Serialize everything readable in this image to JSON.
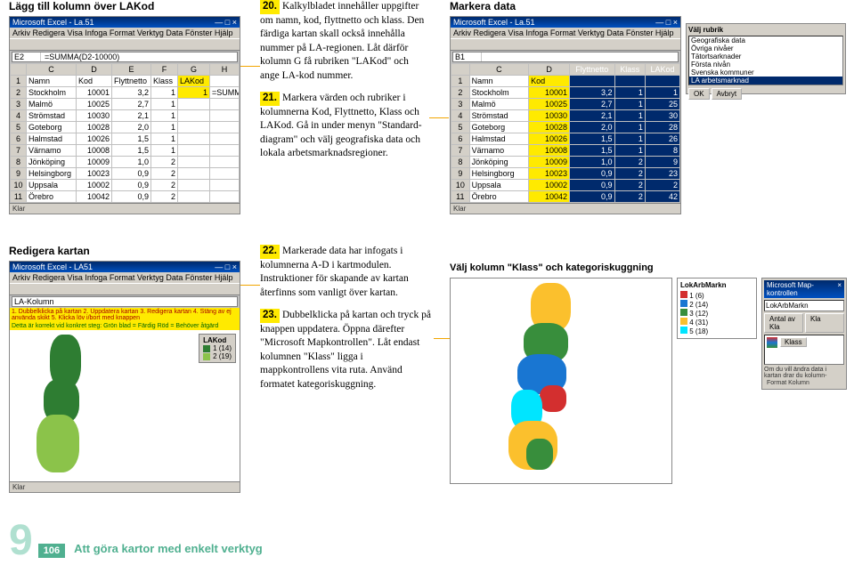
{
  "headings": {
    "h1": "Lägg till kolumn över LAKod",
    "h2": "Markera data",
    "h3": "Redigera kartan",
    "h4": "Välj kolumn \"Klass\" och kategoriskuggning"
  },
  "steps": {
    "s20": {
      "num": "20.",
      "text": "Kalkylbladet innehåller uppgifter om namn, kod, flyttnetto och klass. Den färdiga kartan skall också innehålla nummer på LA-regionen. Låt därför kolumn G få rubriken \"LAKod\" och ange LA-kod nummer."
    },
    "s21": {
      "num": "21.",
      "text": "Markera värden och rubriker i kolumnerna Kod, Flyttnetto, Klass och LAKod. Gå in under menyn \"Standard-diagram\" och välj geografiska data och lokala arbetsmarknadsregioner."
    },
    "s22": {
      "num": "22.",
      "text": "Markerade data har infogats i kolumnerna A-D i kartmodulen. Instruktioner för skapande av kartan återfinns som vanligt över kartan."
    },
    "s23": {
      "num": "23.",
      "text": "Dubbelklicka på kartan och tryck på knappen uppdatera. Öppna därefter \"Microsoft Mapkontrollen\". Låt endast kolumnen \"Klass\" ligga i mappkontrollens vita ruta. Använd formatet kategoriskuggning."
    }
  },
  "excel_common": {
    "title": "Microsoft Excel - La.51",
    "menus": "Arkiv  Redigera  Visa  Infoga  Format  Verktyg  Data  Fönster  Hjälp",
    "status": "Klar"
  },
  "fig1": {
    "formula_ref": "E2",
    "formula_val": "=SUMMA(D2-10000)",
    "cols": [
      "",
      "C",
      "D",
      "E",
      "F",
      "G",
      "H"
    ],
    "header_row": [
      "1",
      "Namn",
      "Kod",
      "Flyttnetto",
      "Klass",
      "LAKod",
      ""
    ],
    "rows": [
      [
        "2",
        "Stockholm",
        "10001",
        "3,2",
        "1",
        "1",
        "=SUMMA(D2-10000)"
      ],
      [
        "3",
        "Malmö",
        "10025",
        "2,7",
        "1",
        "",
        ""
      ],
      [
        "4",
        "Strömstad",
        "10030",
        "2,1",
        "1",
        "",
        ""
      ],
      [
        "5",
        "Goteborg",
        "10028",
        "2,0",
        "1",
        "",
        ""
      ],
      [
        "6",
        "Halmstad",
        "10026",
        "1,5",
        "1",
        "",
        ""
      ],
      [
        "7",
        "Värnamo",
        "10008",
        "1,5",
        "1",
        "",
        ""
      ],
      [
        "8",
        "Jönköping",
        "10009",
        "1,0",
        "2",
        "",
        ""
      ],
      [
        "9",
        "Helsingborg",
        "10023",
        "0,9",
        "2",
        "",
        ""
      ],
      [
        "10",
        "Uppsala",
        "10002",
        "0,9",
        "2",
        "",
        ""
      ],
      [
        "11",
        "Örebro",
        "10042",
        "0,9",
        "2",
        "",
        ""
      ]
    ]
  },
  "fig2": {
    "formula_ref": "B1",
    "cols": [
      "",
      "C",
      "D"
    ],
    "header_row": [
      "1",
      "Namn",
      "Kod"
    ],
    "rows": [
      [
        "2",
        "Stockholm",
        "10001",
        "3,2",
        "1"
      ],
      [
        "3",
        "Malmö",
        "10025",
        "2,7",
        "1"
      ],
      [
        "4",
        "Strömstad",
        "10030",
        "2,1",
        "1"
      ],
      [
        "5",
        "Goteborg",
        "10028",
        "2,0",
        "1"
      ],
      [
        "6",
        "Halmstad",
        "10026",
        "1,5",
        "1"
      ],
      [
        "7",
        "Värnamo",
        "10008",
        "1,5",
        "1"
      ],
      [
        "8",
        "Jönköping",
        "10009",
        "1,0",
        "2"
      ],
      [
        "9",
        "Helsingborg",
        "10023",
        "0,9",
        "2"
      ],
      [
        "10",
        "Uppsala",
        "10002",
        "0,9",
        "2"
      ],
      [
        "11",
        "Örebro",
        "10042",
        "0,9",
        "2"
      ]
    ],
    "selcols": [
      "Flyttnetto",
      "Klass",
      "LAKod"
    ],
    "selextra": [
      "1",
      "25",
      "30",
      "28",
      "26",
      "8",
      "9",
      "23",
      "2",
      "42"
    ],
    "sidepanel": {
      "title": "Välj rubrik",
      "items": [
        "Geografiska data",
        "Övriga nivåer",
        "Tätortsarknader",
        "Första nivån",
        "Svenska kommuner"
      ],
      "hl_index": 4,
      "item_la": "LA arbetsmarknad",
      "buttons": [
        "OK",
        "Avbryt"
      ]
    }
  },
  "fig3": {
    "title": "Microsoft Excel - LA51",
    "cell_ref": "LA-Kolumn",
    "tabs_label": "1. Dubbelklicka på kartan  2. Uppdatera kartan  3. Redigera kartan  4. Stäng av ej använda skikt  5. Klicka löv i/bort med knappen",
    "tabs_label2": "Detta är korrekt vid konkret steg:  Grön blad = Färdig  Röd = Behöver åtgärd",
    "legend": {
      "title": "LAKod",
      "items": [
        {
          "color": "#2e7d32",
          "label": "1 (14)"
        },
        {
          "color": "#8bc34a",
          "label": "2 (19)"
        }
      ]
    }
  },
  "fig4": {
    "legend_title": "LokArbMarkn",
    "legend_items": [
      {
        "color": "#d32f2f",
        "label": "1  (6)"
      },
      {
        "color": "#1976d2",
        "label": "2  (14)"
      },
      {
        "color": "#388e3c",
        "label": "3  (12)"
      },
      {
        "color": "#fbc02d",
        "label": "4  (31)"
      },
      {
        "color": "#00e5ff",
        "label": "5  (18)"
      }
    ],
    "flyout": {
      "title": "Microsoft Map-kontrollen",
      "row1": "LokArbMarkn",
      "label1": "Antal av Kla",
      "label2": "Kla",
      "footer": "Om du vill ändra data i kartan drar du kolumn-",
      "btns_row": "Format   Kolumn",
      "cell": "Klass"
    }
  },
  "footer": {
    "nine": "9",
    "page": "106",
    "chapter": "Att göra kartor med enkelt verktyg"
  }
}
